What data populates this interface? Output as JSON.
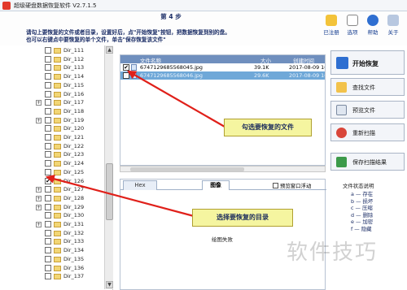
{
  "window": {
    "title": "超级硬盘数据恢复软件 V2.7.1.5"
  },
  "header": {
    "step": "第 4 步",
    "instruction_line1": "请勾上要恢复的文件或者目录，设置好后，点\"开始恢复\"按钮，把数据恢复到别的盘。",
    "instruction_line2": "也可以右键点中要恢复的单个文件，单击\"保存恢复该文件\""
  },
  "toolbar": {
    "register_label": "已注册",
    "options_label": "选项",
    "help_label": "帮助",
    "about_label": "关于"
  },
  "tree": {
    "items": [
      {
        "label": "Dir_111",
        "expander": "",
        "checked": ""
      },
      {
        "label": "Dir_112",
        "expander": "",
        "checked": ""
      },
      {
        "label": "Dir_113",
        "expander": "",
        "checked": ""
      },
      {
        "label": "Dir_114",
        "expander": "",
        "checked": ""
      },
      {
        "label": "Dir_115",
        "expander": "",
        "checked": ""
      },
      {
        "label": "Dir_116",
        "expander": "",
        "checked": ""
      },
      {
        "label": "Dir_117",
        "expander": "+",
        "checked": ""
      },
      {
        "label": "Dir_118",
        "expander": "",
        "checked": ""
      },
      {
        "label": "Dir_119",
        "expander": "+",
        "checked": ""
      },
      {
        "label": "Dir_120",
        "expander": "",
        "checked": ""
      },
      {
        "label": "Dir_121",
        "expander": "",
        "checked": ""
      },
      {
        "label": "Dir_122",
        "expander": "",
        "checked": ""
      },
      {
        "label": "Dir_123",
        "expander": "",
        "checked": ""
      },
      {
        "label": "Dir_124",
        "expander": "",
        "checked": ""
      },
      {
        "label": "Dir_125",
        "expander": "",
        "checked": ""
      },
      {
        "label": "Dir_126",
        "expander": "",
        "checked": "✔"
      },
      {
        "label": "Dir_127",
        "expander": "+",
        "checked": ""
      },
      {
        "label": "Dir_128",
        "expander": "+",
        "checked": ""
      },
      {
        "label": "Dir_129",
        "expander": "+",
        "checked": ""
      },
      {
        "label": "Dir_130",
        "expander": "",
        "checked": ""
      },
      {
        "label": "Dir_131",
        "expander": "+",
        "checked": ""
      },
      {
        "label": "Dir_132",
        "expander": "",
        "checked": ""
      },
      {
        "label": "Dir_133",
        "expander": "",
        "checked": ""
      },
      {
        "label": "Dir_134",
        "expander": "",
        "checked": ""
      },
      {
        "label": "Dir_135",
        "expander": "",
        "checked": ""
      },
      {
        "label": "Dir_136",
        "expander": "",
        "checked": ""
      },
      {
        "label": "Dir_137",
        "expander": "",
        "checked": ""
      }
    ]
  },
  "files": {
    "columns": {
      "name": "文件名称",
      "size": "大小",
      "date": "创建时间"
    },
    "rows": [
      {
        "checked": "✔",
        "name": "6747129685568045.jpg",
        "size": "39.1K",
        "date": "2017-08-09 16:5"
      },
      {
        "checked": "✔",
        "name": "6747129685568046.jpg",
        "size": "29.6K",
        "date": "2017-08-09 16:5"
      }
    ]
  },
  "preview": {
    "tab_hex": "Hex",
    "tab_image": "图像",
    "float_label": "预览窗口浮动",
    "load_fail": "绘图失败"
  },
  "actions": {
    "start_label": "开始恢复",
    "find_label": "查找文件",
    "preview_label": "预览文件",
    "rescan_label": "重新扫描",
    "save_scan_label": "保存扫描结果"
  },
  "legend": {
    "title": "文件状态说明",
    "items": [
      "a — 存在",
      "b — 损坏",
      "c — 压缩",
      "d — 删除",
      "e — 加密",
      "f — 隐藏"
    ]
  },
  "annotations": {
    "files_callout": "勾选要恢复的文件",
    "dir_callout": "选择要恢复的目录"
  },
  "watermark": "软件技巧",
  "colors": {
    "accent": "#1b2d66",
    "list_header": "#6f8fbe",
    "highlight_row": "#6fa8d8",
    "callout_bg": "#f5f5a0",
    "arrow": "#e0201a"
  }
}
